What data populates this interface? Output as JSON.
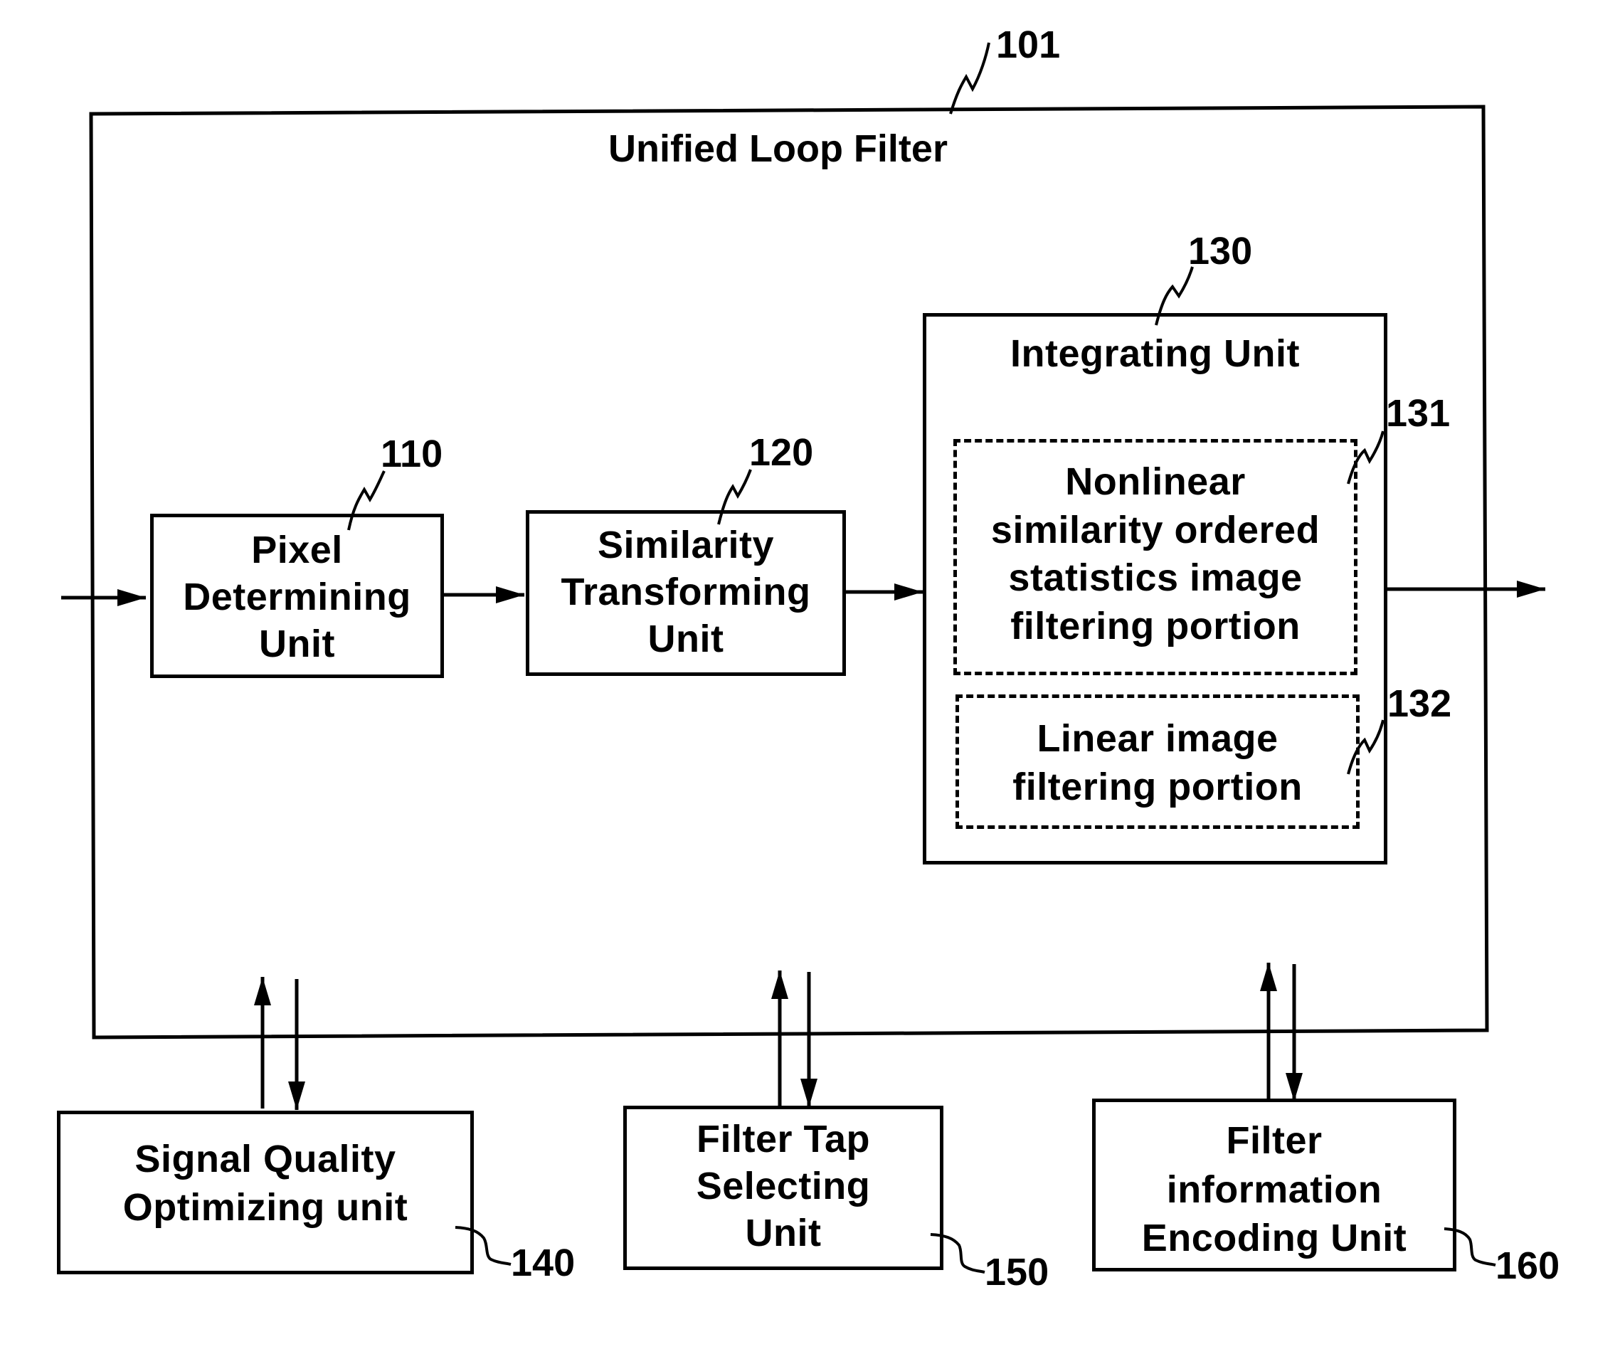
{
  "diagram": {
    "container": {
      "ref": "101",
      "title": "Unified Loop Filter"
    },
    "blocks": {
      "pixel_determining": {
        "ref": "110",
        "lines": [
          "Pixel",
          "Determining",
          "Unit"
        ]
      },
      "similarity_transforming": {
        "ref": "120",
        "lines": [
          "Similarity",
          "Transforming",
          "Unit"
        ]
      },
      "integrating": {
        "ref": "130",
        "title": "Integrating Unit"
      },
      "nonlinear_portion": {
        "ref": "131",
        "lines": [
          "Nonlinear",
          "similarity ordered",
          "statistics image",
          "filtering portion"
        ]
      },
      "linear_portion": {
        "ref": "132",
        "lines": [
          "Linear image",
          "filtering portion"
        ]
      },
      "signal_quality": {
        "ref": "140",
        "lines": [
          "Signal Quality",
          "Optimizing unit"
        ]
      },
      "filter_tap": {
        "ref": "150",
        "lines": [
          "Filter Tap",
          "Selecting",
          "Unit"
        ]
      },
      "filter_info": {
        "ref": "160",
        "lines": [
          "Filter",
          "information",
          "Encoding Unit"
        ]
      }
    },
    "connections": [
      {
        "from": "input",
        "to": "pixel_determining"
      },
      {
        "from": "pixel_determining",
        "to": "similarity_transforming"
      },
      {
        "from": "similarity_transforming",
        "to": "integrating"
      },
      {
        "from": "integrating",
        "to": "output"
      },
      {
        "from": "signal_quality",
        "to": "container",
        "bidirectional": true
      },
      {
        "from": "filter_tap",
        "to": "container",
        "bidirectional": true
      },
      {
        "from": "filter_info",
        "to": "container",
        "bidirectional": true
      }
    ]
  }
}
